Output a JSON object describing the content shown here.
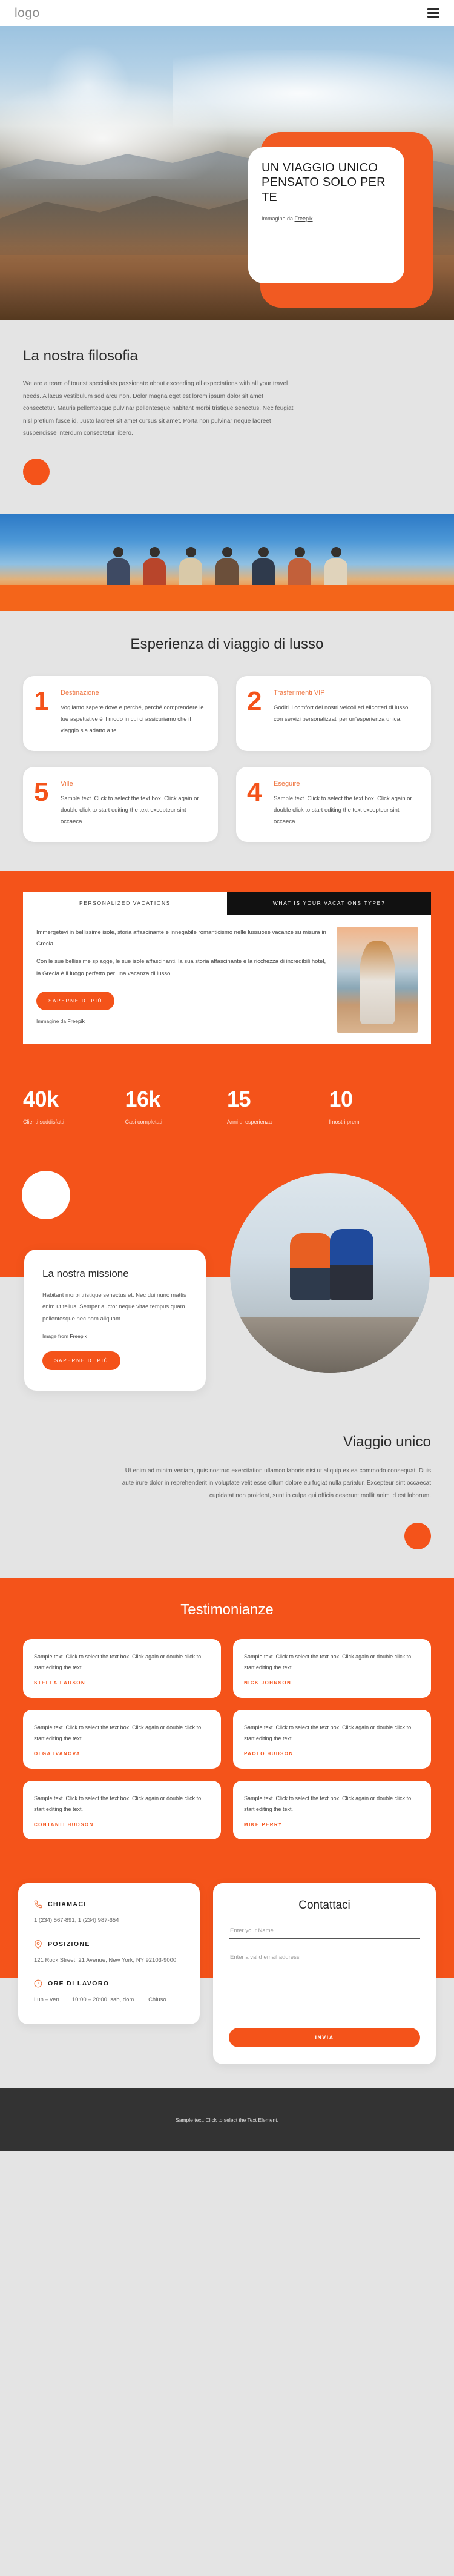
{
  "theme": {
    "accent": "#f4531a",
    "accent_light": "#ef7743",
    "page_bg": "#e4e4e4",
    "footer_bg": "#333333"
  },
  "header": {
    "logo": "logo",
    "menu_icon": "hamburger-menu-icon"
  },
  "hero": {
    "title": "UN VIAGGIO UNICO PENSATO SOLO PER TE",
    "credit_prefix": "Immagine da ",
    "credit_link": "Freepik"
  },
  "philosophy": {
    "title": "La nostra filosofia",
    "body": "We are a team of tourist specialists passionate about exceeding all expectations with all your travel needs. A lacus vestibulum sed arcu non. Dolor magna eget est lorem ipsum dolor sit amet consectetur. Mauris pellentesque pulvinar pellentesque habitant morbi tristique senectus. Nec feugiat nisl pretium fusce id. Justo laoreet sit amet cursus sit amet. Porta non pulvinar neque laoreet suspendisse interdum consectetur libero."
  },
  "experience": {
    "title": "Esperienza di viaggio di lusso",
    "cards": [
      {
        "num": "1",
        "title": "Destinazione",
        "text": "Vogliamo sapere dove e perché, perché comprendere le tue aspettative è il modo in cui ci assicuriamo che il viaggio sia adatto a te."
      },
      {
        "num": "2",
        "title": "Trasferimenti VIP",
        "text": "Goditi il comfort dei nostri veicoli ed elicotteri di lusso con servizi personalizzati per un'esperienza unica."
      },
      {
        "num": "5",
        "title": "Ville",
        "text": "Sample text. Click to select the text box. Click again or double click to start editing the text excepteur sint occaeca."
      },
      {
        "num": "4",
        "title": "Eseguire",
        "text": "Sample text. Click to select the text box. Click again or double click to start editing the text excepteur sint occaeca."
      }
    ]
  },
  "tabs_section": {
    "tabs": [
      {
        "label": "PERSONALIZED VACATIONS",
        "active": true
      },
      {
        "label": "WHAT IS YOUR VACATIONS TYPE?",
        "active": false
      }
    ],
    "paragraph1": "Immergetevi in bellissime isole, storia affascinante e innegabile romanticismo nelle lussuose vacanze su misura in Grecia.",
    "paragraph2": "Con le sue bellissime spiagge, le sue isole affascinanti, la sua storia affascinante e la ricchezza di incredibili hotel, la Grecia è il luogo perfetto per una vacanza di lusso.",
    "cta": "SAPERNE DI PIÙ",
    "credit_prefix": "Immagine da ",
    "credit_link": "Freepik"
  },
  "stats": [
    {
      "value": "40k",
      "label": "Clienti soddisfatti"
    },
    {
      "value": "16k",
      "label": "Casi completati"
    },
    {
      "value": "15",
      "label": "Anni di esperienza"
    },
    {
      "value": "10",
      "label": "I nostri premi"
    }
  ],
  "mission": {
    "title": "La nostra missione",
    "body": "Habitant morbi tristique senectus et. Nec dui nunc mattis enim ut tellus. Semper auctor neque vitae tempus quam pellentesque nec nam aliquam.",
    "credit_prefix": "Image from ",
    "credit_link": "Freepik",
    "cta": "SAPERNE DI PIÙ"
  },
  "unique": {
    "title": "Viaggio unico",
    "body": "Ut enim ad minim veniam, quis nostrud exercitation ullamco laboris nisi ut aliquip ex ea commodo consequat. Duis aute irure dolor in reprehenderit in voluptate velit esse cillum dolore eu fugiat nulla pariatur. Excepteur sint occaecat cupidatat non proident, sunt in culpa qui officia deserunt mollit anim id est laborum."
  },
  "testimonials": {
    "title": "Testimonianze",
    "items": [
      {
        "text": "Sample text. Click to select the text box. Click again or double click to start editing the text.",
        "name": "STELLA LARSON"
      },
      {
        "text": "Sample text. Click to select the text box. Click again or double click to start editing the text.",
        "name": "NICK JOHNSON"
      },
      {
        "text": "Sample text. Click to select the text box. Click again or double click to start editing the text.",
        "name": "OLGA IVANOVA"
      },
      {
        "text": "Sample text. Click to select the text box. Click again or double click to start editing the text.",
        "name": "PAOLO HUDSON"
      },
      {
        "text": "Sample text. Click to select the text box. Click again or double click to start editing the text.",
        "name": "CONTANTI HUDSON"
      },
      {
        "text": "Sample text. Click to select the text box. Click again or double click to start editing the text.",
        "name": "MIKE PERRY"
      }
    ]
  },
  "contact": {
    "info": [
      {
        "icon": "phone-icon",
        "title": "CHIAMACI",
        "value": "1 (234) 567-891, 1 (234) 987-654"
      },
      {
        "icon": "location-pin-icon",
        "title": "POSIZIONE",
        "value": "121 Rock Street, 21 Avenue, New York, NY 92103-9000"
      },
      {
        "icon": "clock-24h-icon",
        "title": "ORE DI LAVORO",
        "value": "Lun – ven ...... 10:00 – 20:00, sab, dom ....... Chiuso"
      }
    ],
    "form": {
      "title": "Contattaci",
      "name_placeholder": "Enter your Name",
      "email_placeholder": "Enter a valid email address",
      "message_placeholder": "",
      "name_value": "",
      "email_value": "",
      "message_value": "",
      "submit": "INVIA"
    }
  },
  "footer": {
    "text": "Sample text. Click to select the Text Element."
  }
}
